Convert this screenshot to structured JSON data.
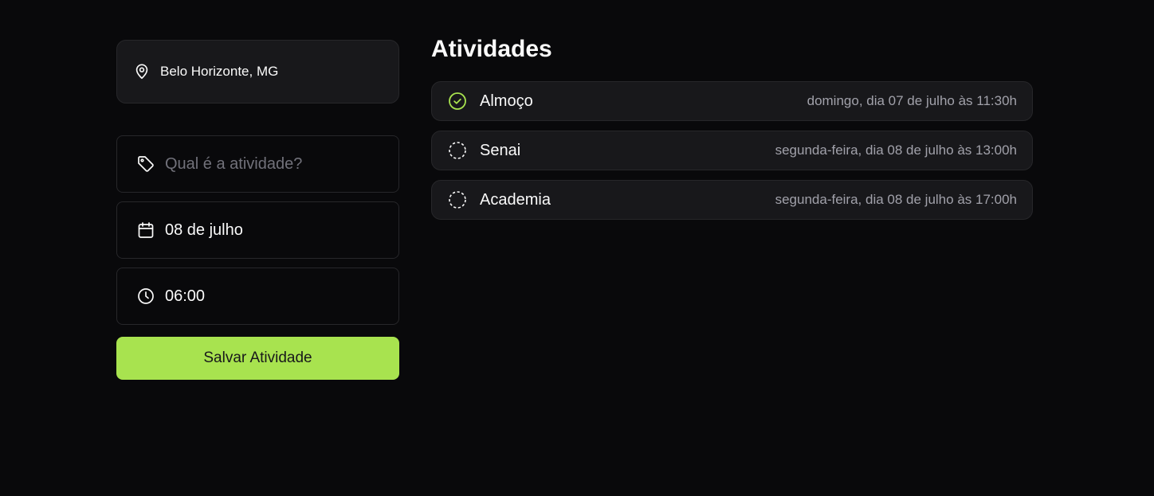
{
  "location": {
    "icon": "map-pin-icon",
    "text": "Belo Horizonte, MG"
  },
  "form": {
    "activity": {
      "icon": "tag-icon",
      "placeholder": "Qual é a atividade?",
      "value": ""
    },
    "date": {
      "icon": "calendar-icon",
      "value": "08 de julho"
    },
    "time": {
      "icon": "clock-icon",
      "value": "06:00"
    },
    "save_label": "Salvar Atividade"
  },
  "activities_section": {
    "title": "Atividades",
    "items": [
      {
        "name": "Almoço",
        "when": "domingo, dia 07 de julho às 11:30h",
        "done": true
      },
      {
        "name": "Senai",
        "when": "segunda-feira, dia 08 de julho às 13:00h",
        "done": false
      },
      {
        "name": "Academia",
        "when": "segunda-feira, dia 08 de julho às 17:00h",
        "done": false
      }
    ]
  },
  "colors": {
    "background": "#09090b",
    "card": "#18181b",
    "border": "#27272a",
    "accent": "#a8e34f",
    "muted_text": "#a1a1aa"
  }
}
